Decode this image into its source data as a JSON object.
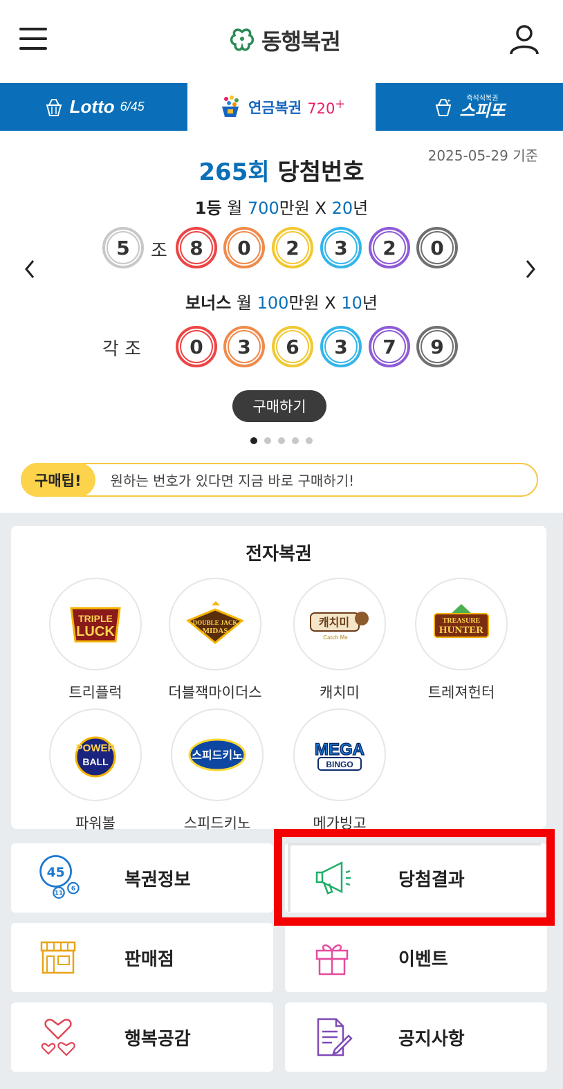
{
  "header": {
    "logo_text": "동행복권",
    "menu_icon": "hamburger-icon",
    "user_icon": "user-icon"
  },
  "tabs": [
    {
      "label": "Lotto",
      "sub": "6/45",
      "active": false
    },
    {
      "label": "연금복권",
      "sub": "720",
      "plus": "+",
      "active": true
    },
    {
      "label": "스피또",
      "sub": "즉석식복권",
      "active": false
    }
  ],
  "draw": {
    "date": "2025-05-29 기준",
    "round": "265회",
    "title_suffix": "당첨번호",
    "first": {
      "rank": "1등",
      "m1": "월 ",
      "amount": "700",
      "m2": "만원 X ",
      "years": "20",
      "m3": "년"
    },
    "group_number": "5",
    "group_label": "조",
    "first_numbers": [
      "8",
      "0",
      "2",
      "3",
      "2",
      "0"
    ],
    "bonus": {
      "rank": "보너스",
      "m1": "월 ",
      "amount": "100",
      "m2": "만원 X ",
      "years": "10",
      "m3": "년"
    },
    "bonus_label": "각 조",
    "bonus_numbers": [
      "0",
      "3",
      "6",
      "3",
      "7",
      "9"
    ],
    "buy_label": "구매하기",
    "pages": 5,
    "active_page": 0
  },
  "ball_colors": [
    "#ee4444",
    "#f08a4b",
    "#f2c832",
    "#33b5ea",
    "#8e5bd6",
    "#707070"
  ],
  "tip": {
    "badge": "구매팁!",
    "text": "원하는 번호가 있다면 지금 바로 구매하기!"
  },
  "e_lottery": {
    "title": "전자복권",
    "games": [
      {
        "label": "트리플럭",
        "logo": "TRIPLE LUCK"
      },
      {
        "label": "더블잭마이더스",
        "logo": "DOUBLE JACK MIDAS"
      },
      {
        "label": "캐치미",
        "logo": "캐치미"
      },
      {
        "label": "트레져헌터",
        "logo": "TREASURE HUNTER"
      },
      {
        "label": "파워볼",
        "logo": "POWER BALL"
      },
      {
        "label": "스피드키노",
        "logo": "스피드키노"
      },
      {
        "label": "메가빙고",
        "logo": "MEGA BINGO"
      }
    ]
  },
  "menu": {
    "info": {
      "label": "복권정보",
      "icon": "lottery-balls-icon",
      "ball_big": "45",
      "ball_small_1": "11",
      "ball_small_2": "6"
    },
    "results": {
      "label": "당첨결과",
      "icon": "megaphone-icon"
    },
    "stores": {
      "label": "판매점",
      "icon": "store-icon"
    },
    "events": {
      "label": "이벤트",
      "icon": "gift-icon"
    },
    "happy": {
      "label": "행복공감",
      "icon": "hearts-icon"
    },
    "notice": {
      "label": "공지사항",
      "icon": "document-edit-icon"
    }
  },
  "accent_color": "#0a6fb8",
  "highlight_color": "#f40000"
}
